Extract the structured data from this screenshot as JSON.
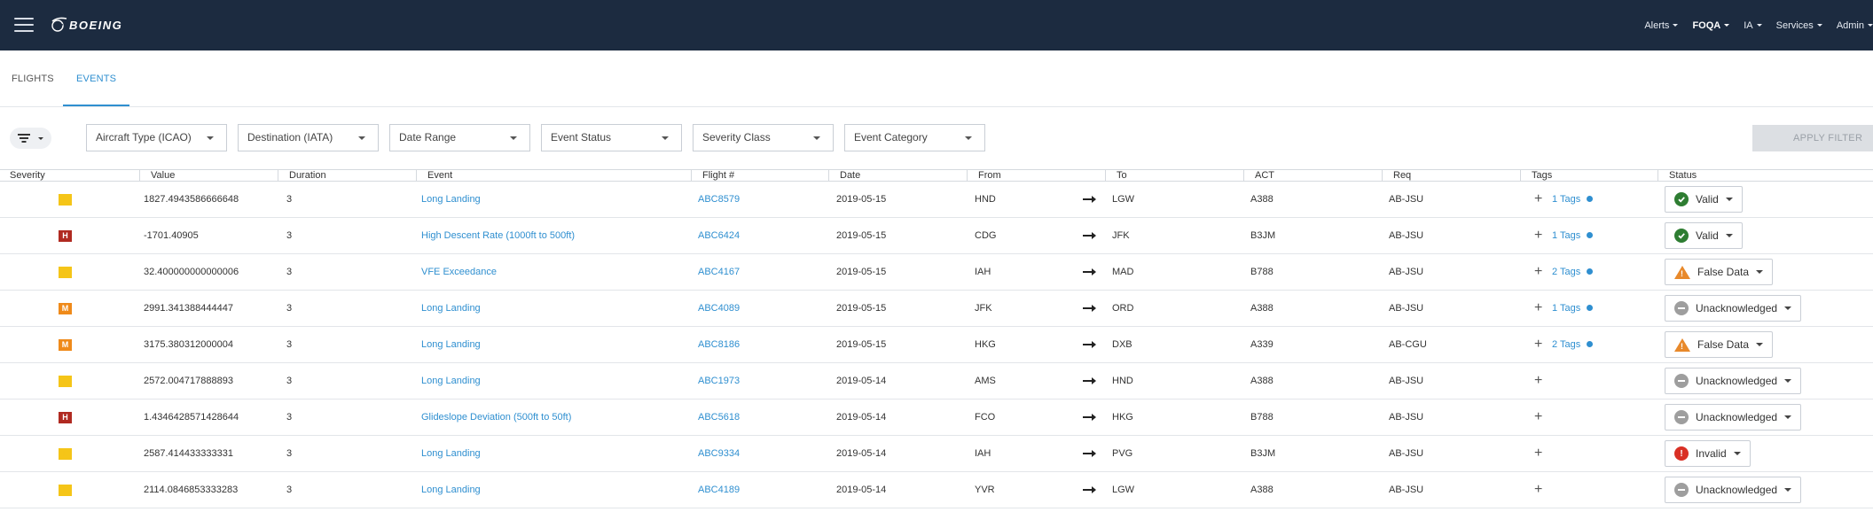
{
  "header": {
    "logo_text": "BOEING",
    "nav": [
      {
        "label": "Alerts",
        "active": false
      },
      {
        "label": "FOQA",
        "active": true
      },
      {
        "label": "IA",
        "active": false
      },
      {
        "label": "Services",
        "active": false
      },
      {
        "label": "Admin",
        "active": false
      }
    ]
  },
  "tabs": [
    {
      "label": "FLIGHTS",
      "active": false
    },
    {
      "label": "EVENTS",
      "active": true
    }
  ],
  "filters": {
    "toggle_icon": "filter-icon",
    "selects": [
      {
        "label": "Aircraft Type (ICAO)"
      },
      {
        "label": "Destination (IATA)"
      },
      {
        "label": "Date Range"
      },
      {
        "label": "Event Status"
      },
      {
        "label": "Severity Class"
      },
      {
        "label": "Event Category"
      }
    ],
    "apply_label": "APPLY FILTER"
  },
  "table": {
    "columns": [
      "Severity",
      "Value",
      "Duration",
      "Event",
      "Flight #",
      "Date",
      "From",
      "To",
      "ACT",
      "Req",
      "Tags",
      "Status"
    ],
    "severity_colors": {
      "L": "#f5c518",
      "M": "#ef8a1a",
      "H": "#b02a21"
    },
    "rows": [
      {
        "severity": "L",
        "value": "1827.4943586666648",
        "duration": "3",
        "event": "Long Landing",
        "flight": "ABC8579",
        "date": "2019-05-15",
        "from": "HND",
        "to": "LGW",
        "act": "A388",
        "req": "AB-JSU",
        "tags": "1 Tags",
        "status": "Valid",
        "status_type": "valid"
      },
      {
        "severity": "H",
        "value": "-1701.40905",
        "duration": "3",
        "event": "High Descent Rate (1000ft to 500ft)",
        "flight": "ABC6424",
        "date": "2019-05-15",
        "from": "CDG",
        "to": "JFK",
        "act": "B3JM",
        "req": "AB-JSU",
        "tags": "1 Tags",
        "status": "Valid",
        "status_type": "valid"
      },
      {
        "severity": "L",
        "value": "32.400000000000006",
        "duration": "3",
        "event": "VFE Exceedance",
        "flight": "ABC4167",
        "date": "2019-05-15",
        "from": "IAH",
        "to": "MAD",
        "act": "B788",
        "req": "AB-JSU",
        "tags": "2 Tags",
        "status": "False Data",
        "status_type": "false"
      },
      {
        "severity": "M",
        "value": "2991.341388444447",
        "duration": "3",
        "event": "Long Landing",
        "flight": "ABC4089",
        "date": "2019-05-15",
        "from": "JFK",
        "to": "ORD",
        "act": "A388",
        "req": "AB-JSU",
        "tags": "1 Tags",
        "status": "Unacknowledged",
        "status_type": "unack"
      },
      {
        "severity": "M",
        "value": "3175.380312000004",
        "duration": "3",
        "event": "Long Landing",
        "flight": "ABC8186",
        "date": "2019-05-15",
        "from": "HKG",
        "to": "DXB",
        "act": "A339",
        "req": "AB-CGU",
        "tags": "2 Tags",
        "status": "False Data",
        "status_type": "false"
      },
      {
        "severity": "L",
        "value": "2572.004717888893",
        "duration": "3",
        "event": "Long Landing",
        "flight": "ABC1973",
        "date": "2019-05-14",
        "from": "AMS",
        "to": "HND",
        "act": "A388",
        "req": "AB-JSU",
        "tags": "",
        "status": "Unacknowledged",
        "status_type": "unack"
      },
      {
        "severity": "H",
        "value": "1.4346428571428644",
        "duration": "3",
        "event": "Glideslope Deviation (500ft to 50ft)",
        "flight": "ABC5618",
        "date": "2019-05-14",
        "from": "FCO",
        "to": "HKG",
        "act": "B788",
        "req": "AB-JSU",
        "tags": "",
        "status": "Unacknowledged",
        "status_type": "unack"
      },
      {
        "severity": "L",
        "value": "2587.414433333331",
        "duration": "3",
        "event": "Long Landing",
        "flight": "ABC9334",
        "date": "2019-05-14",
        "from": "IAH",
        "to": "PVG",
        "act": "B3JM",
        "req": "AB-JSU",
        "tags": "",
        "status": "Invalid",
        "status_type": "invalid"
      },
      {
        "severity": "L",
        "value": "2114.0846853333283",
        "duration": "3",
        "event": "Long Landing",
        "flight": "ABC4189",
        "date": "2019-05-14",
        "from": "YVR",
        "to": "LGW",
        "act": "A388",
        "req": "AB-JSU",
        "tags": "",
        "status": "Unacknowledged",
        "status_type": "unack"
      }
    ]
  }
}
